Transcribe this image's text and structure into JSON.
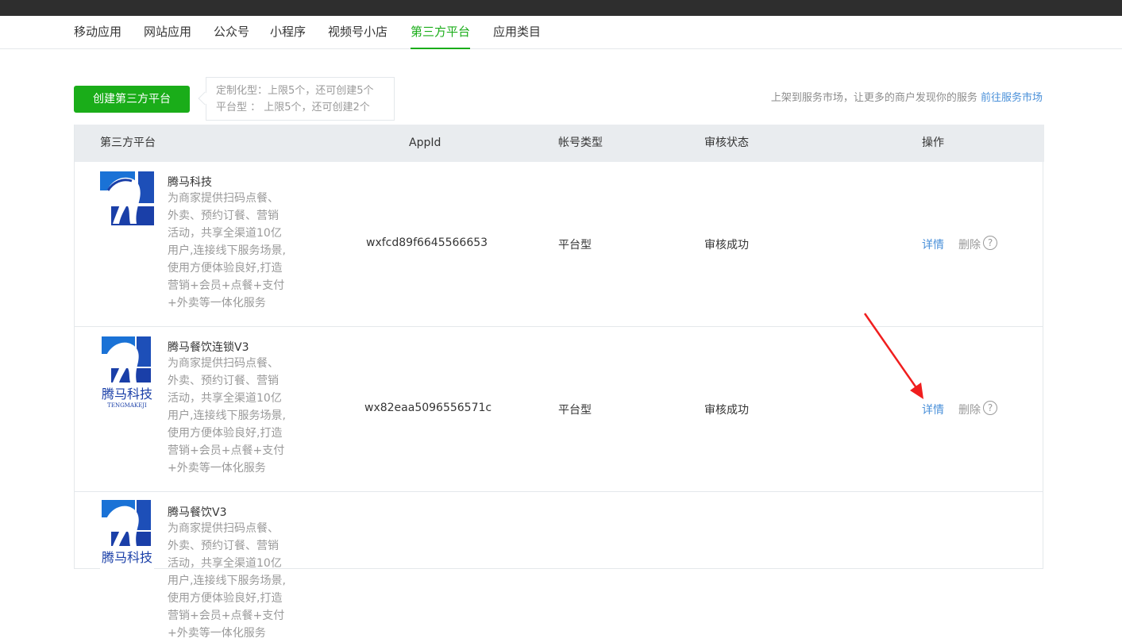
{
  "nav": {
    "tabs": [
      "移动应用",
      "网站应用",
      "公众号",
      "小程序",
      "视频号小店",
      "第三方平台",
      "应用类目"
    ],
    "active": "第三方平台"
  },
  "toolbar": {
    "create_label": "创建第三方平台",
    "tip_line1": "定制化型：上限5个，还可创建5个",
    "tip_line2": "平台型 ：  上限5个，还可创建2个",
    "market_text": "上架到服务市场，让更多的商户发现你的服务",
    "market_link": "前往服务市场"
  },
  "table": {
    "headers": [
      "第三方平台",
      "AppId",
      "帐号类型",
      "审核状态",
      "操作"
    ],
    "rows": [
      {
        "name": "腾马科技",
        "desc": "为商家提供扫码点餐、外卖、预约订餐、营销活动，共享全渠道10亿用户,连接线下服务场景,使用方便体验良好,打造营销+会员+点餐+支付+外卖等一体化服务",
        "appid": "wxfcd89f6645566653",
        "type": "平台型",
        "status": "审核成功",
        "detail": "详情",
        "delete": "删除"
      },
      {
        "name": "腾马餐饮连锁V3",
        "desc": "为商家提供扫码点餐、外卖、预约订餐、营销活动，共享全渠道10亿用户,连接线下服务场景,使用方便体验良好,打造营销+会员+点餐+支付+外卖等一体化服务",
        "appid": "wx82eaa5096556571c",
        "type": "平台型",
        "status": "审核成功",
        "detail": "详情",
        "delete": "删除",
        "logo_text": "腾马科技",
        "logo_sub": "TENGMAKEJI"
      },
      {
        "name": "腾马餐饮V3",
        "desc": "为商家提供扫码点餐、外卖、预约订餐、营销活动，共享全渠道10亿用户,连接线下服务场景,使用方便体验良好,打造营销+会员+点餐+支付+外卖等一体化服务",
        "logo_text": "腾马科技"
      }
    ]
  },
  "help_glyph": "?",
  "colors": {
    "accent": "#1aad19",
    "link": "#4a90d9",
    "annotation": "#f01e1e"
  }
}
